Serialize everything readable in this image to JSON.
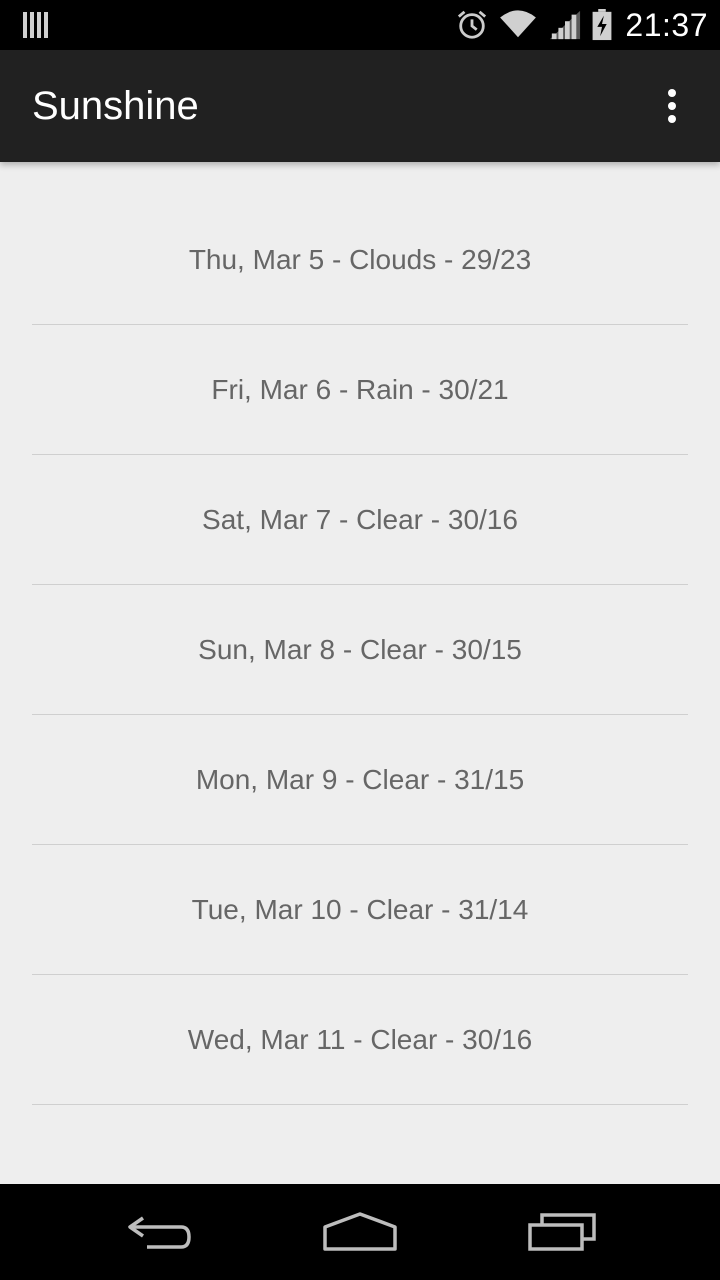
{
  "status_bar": {
    "time": "21:37",
    "icons": [
      "notification-icon",
      "alarm-icon",
      "wifi-icon",
      "cell-signal-icon",
      "battery-charging-icon"
    ]
  },
  "action_bar": {
    "title": "Sunshine",
    "overflow_icon": "overflow-menu-icon"
  },
  "forecast": [
    "Thu, Mar 5 - Clouds - 29/23",
    "Fri, Mar 6 - Rain - 30/21",
    "Sat, Mar 7 - Clear - 30/16",
    "Sun, Mar 8 - Clear - 30/15",
    "Mon, Mar 9 - Clear - 31/15",
    "Tue, Mar 10 - Clear - 31/14",
    "Wed, Mar 11 - Clear - 30/16"
  ],
  "nav_bar": {
    "icons": [
      "back-icon",
      "home-icon",
      "recents-icon"
    ]
  },
  "colors": {
    "status_bar": "#000000",
    "action_bar": "#212121",
    "background": "#eeeeee",
    "list_text": "#666666",
    "divider": "#cfcfcf"
  }
}
